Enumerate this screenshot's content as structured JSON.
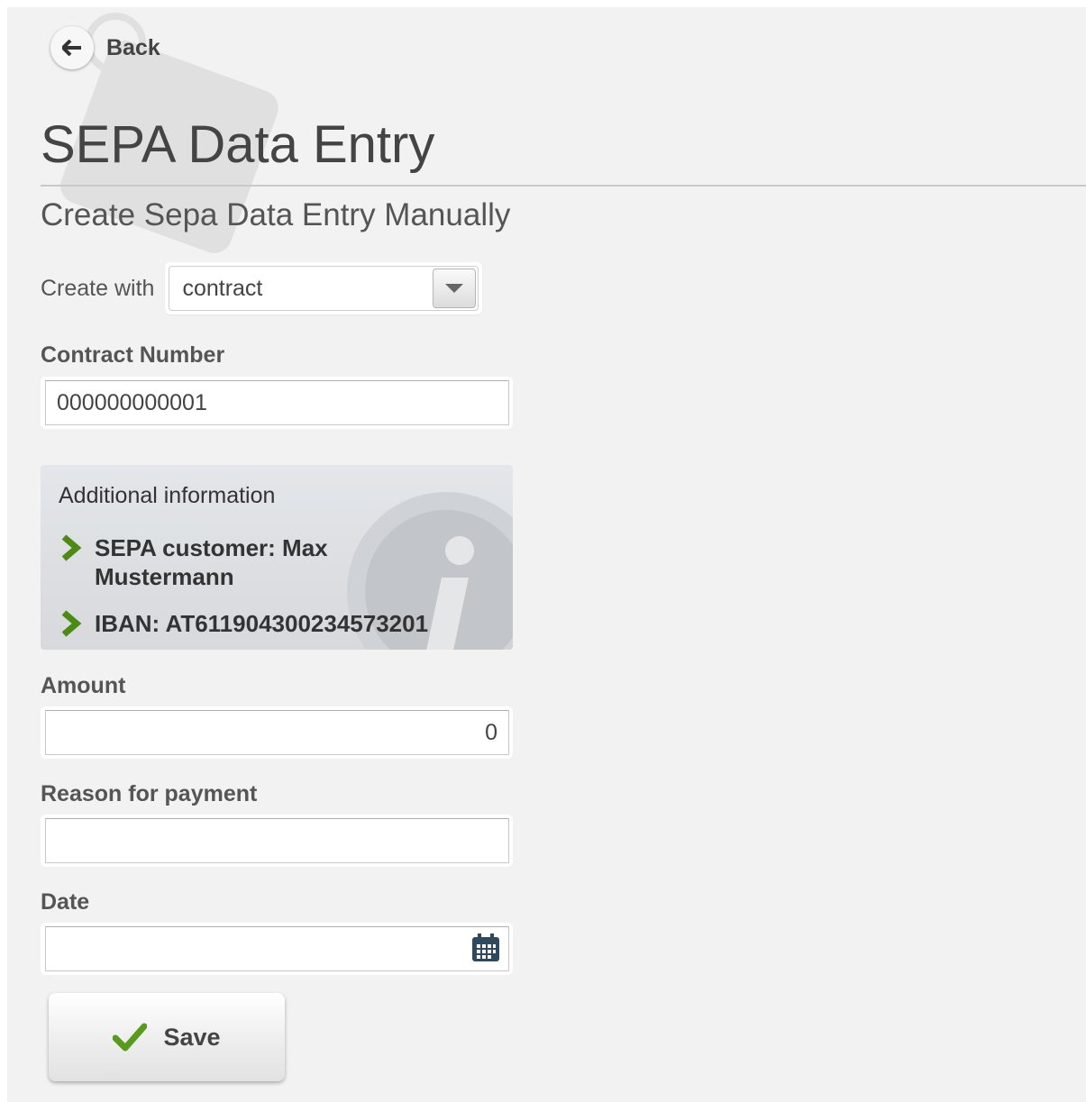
{
  "back": {
    "label": "Back"
  },
  "header": {
    "title": "SEPA Data Entry",
    "subtitle": "Create Sepa Data Entry Manually"
  },
  "create_with": {
    "label": "Create with",
    "selected": "contract"
  },
  "contract_number": {
    "label": "Contract Number",
    "value": "000000000001"
  },
  "additional_info": {
    "title": "Additional information",
    "items": [
      {
        "text": "SEPA customer: Max Mustermann"
      },
      {
        "text": "IBAN: AT611904300234573201"
      }
    ]
  },
  "amount": {
    "label": "Amount",
    "value": "0"
  },
  "reason": {
    "label": "Reason for payment",
    "value": ""
  },
  "date": {
    "label": "Date",
    "value": ""
  },
  "save": {
    "label": "Save"
  },
  "colors": {
    "check_green": "#5a9a1a",
    "chevron_green": "#4c8a14",
    "calendar": "#2f4a5e"
  },
  "icons": [
    "arrow-left-icon",
    "chevron-down-icon",
    "chevron-right-icon",
    "info-icon",
    "calendar-icon",
    "checkmark-icon"
  ]
}
